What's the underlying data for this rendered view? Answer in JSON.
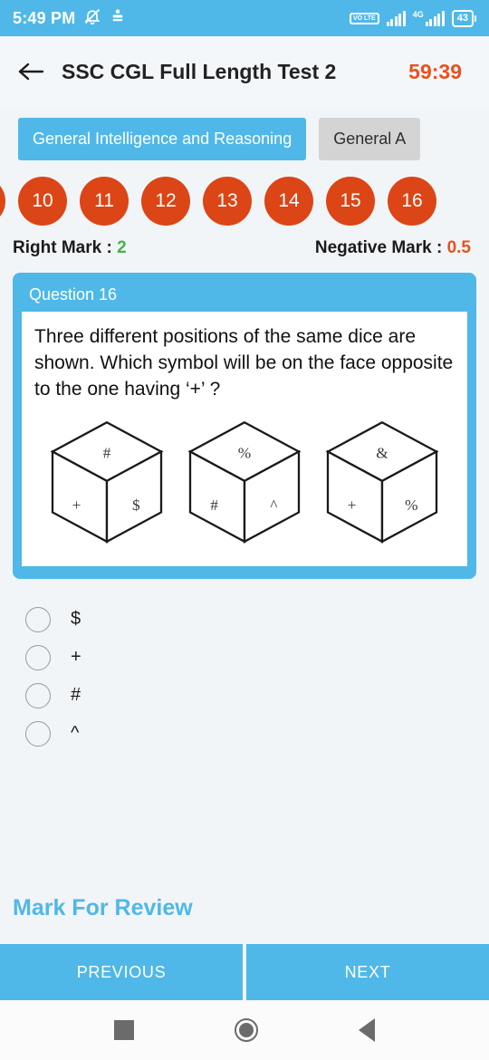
{
  "status_bar": {
    "time": "5:49 PM",
    "icons": [
      "bell-muted-icon",
      "app-notification-icon"
    ],
    "volte_label": "VO LTE",
    "network_label": "4G",
    "battery_level": "43"
  },
  "header": {
    "back_icon": "back-arrow-icon",
    "title": "SSC CGL Full Length Test 2",
    "timer": "59:39"
  },
  "section_tabs": [
    {
      "label": "General Intelligence and Reasoning",
      "active": true
    },
    {
      "label": "General A",
      "active": false
    }
  ],
  "question_numbers": [
    {
      "label": "",
      "partial": true
    },
    {
      "label": "10",
      "partial": false
    },
    {
      "label": "11",
      "partial": false
    },
    {
      "label": "12",
      "partial": false
    },
    {
      "label": "13",
      "partial": false
    },
    {
      "label": "14",
      "partial": false
    },
    {
      "label": "15",
      "partial": false
    },
    {
      "label": "16",
      "partial": false
    }
  ],
  "marks": {
    "right_label": "Right Mark : ",
    "right_value": "2",
    "negative_label": "Negative Mark : ",
    "negative_value": "0.5"
  },
  "question": {
    "number_label": "Question 16",
    "text": "Three different positions of the same dice are shown. Which symbol will be on the face opposite to the one having ‘+’ ?",
    "dice": [
      {
        "top": "#",
        "left": "+",
        "right": "$"
      },
      {
        "top": "%",
        "left": "#",
        "right": "^"
      },
      {
        "top": "&",
        "left": "+",
        "right": "%"
      }
    ]
  },
  "options": [
    {
      "label": "$",
      "selected": false
    },
    {
      "label": "+",
      "selected": false
    },
    {
      "label": "#",
      "selected": false
    },
    {
      "label": "^",
      "selected": false
    }
  ],
  "mark_for_review": "Mark For Review",
  "bottom_buttons": [
    {
      "label": "PREVIOUS"
    },
    {
      "label": "NEXT"
    }
  ],
  "android_nav": [
    "recents-square-icon",
    "home-circle-icon",
    "back-triangle-icon"
  ],
  "colors": {
    "accent_blue": "#4fb8e8",
    "orange": "#e8521f",
    "circle_orange": "#dc4516",
    "green": "#49b24a",
    "page_bg": "#f2f5f8"
  }
}
